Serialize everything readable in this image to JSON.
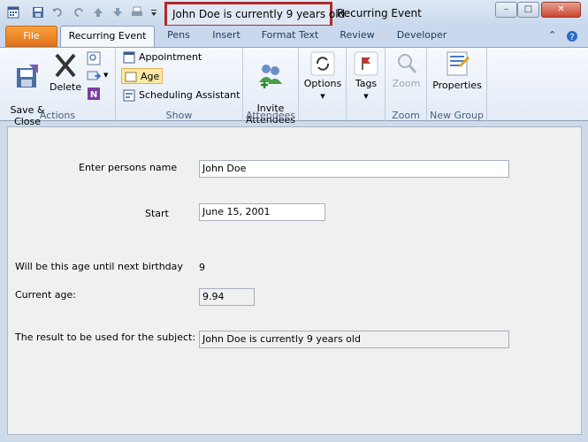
{
  "window": {
    "subject_title": "John  Doe is currently 9 years old",
    "title": "Recurring Event",
    "controls": {
      "minimize": "–",
      "maximize": "□",
      "close": "✕"
    }
  },
  "ribbon_tabs": [
    {
      "label": "File"
    },
    {
      "label": "Recurring Event"
    },
    {
      "label": "Pens"
    },
    {
      "label": "Insert"
    },
    {
      "label": "Format Text"
    },
    {
      "label": "Review"
    },
    {
      "label": "Developer"
    }
  ],
  "ribbon": {
    "actions": {
      "group_label": "Actions",
      "save_close": "Save &\nClose",
      "delete": "Delete"
    },
    "show": {
      "group_label": "Show",
      "appointment": "Appointment",
      "age": "Age",
      "scheduling": "Scheduling Assistant"
    },
    "attendees": {
      "group_label": "Attendees",
      "invite": "Invite\nAttendees"
    },
    "options": {
      "label": "Options"
    },
    "tags": {
      "label": "Tags"
    },
    "zoom": {
      "group_label": "Zoom",
      "label": "Zoom"
    },
    "new_group": {
      "group_label": "New Group",
      "properties": "Properties"
    }
  },
  "form": {
    "name_label": "Enter persons name",
    "name_value": "John  Doe",
    "start_label": "Start",
    "start_value": "June 15, 2001",
    "age_until_label": "Will be this age until next birthday",
    "age_until_value": "9",
    "current_age_label": "Current age:",
    "current_age_value": "9.94",
    "result_label": "The result to be used for the subject:",
    "result_value": "John  Doe is currently 9 years old"
  }
}
